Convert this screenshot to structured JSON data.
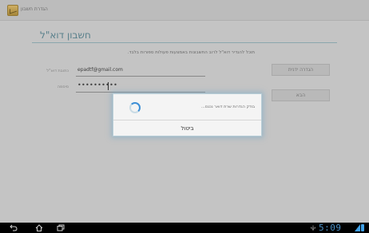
{
  "app": {
    "title": "הגדרת חשבון"
  },
  "page": {
    "title": "חשבון דוא\"ל",
    "subtitle": "תוכל להגדיר דוא\"ל לרוב החשבונות באמצעות פעולות ספורות בלבד."
  },
  "form": {
    "email_label": "כתובת דוא\"ל",
    "email_value": "epadtf@gmail.com",
    "password_label": "סיסמה",
    "password_value": "••••••••••"
  },
  "buttons": {
    "manual_setup": "הגדרה ידנית",
    "next": "הבא"
  },
  "dialog": {
    "message": "בודק הגדרות שרת דואר נכנס...",
    "cancel": "ביטול"
  },
  "status_bar": {
    "time": "5:09"
  },
  "colors": {
    "accent": "#5e8793",
    "clock": "#4a8fc4",
    "spinner": "#3d8fd6"
  },
  "icons": [
    "app-icon",
    "back-icon",
    "home-icon",
    "recents-icon",
    "usb-icon",
    "signal-icon",
    "battery-icon"
  ]
}
